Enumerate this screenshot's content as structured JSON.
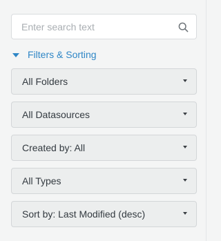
{
  "search": {
    "placeholder": "Enter search text",
    "value": "",
    "icon": "search-icon"
  },
  "filters": {
    "toggle_label": "Filters & Sorting",
    "expanded": true,
    "accent_color": "#2e86c6",
    "dropdowns": [
      {
        "label": "All Folders"
      },
      {
        "label": "All Datasources"
      },
      {
        "label": "Created by: All"
      },
      {
        "label": "All Types"
      },
      {
        "label": "Sort by: Last Modified (desc)"
      }
    ]
  }
}
